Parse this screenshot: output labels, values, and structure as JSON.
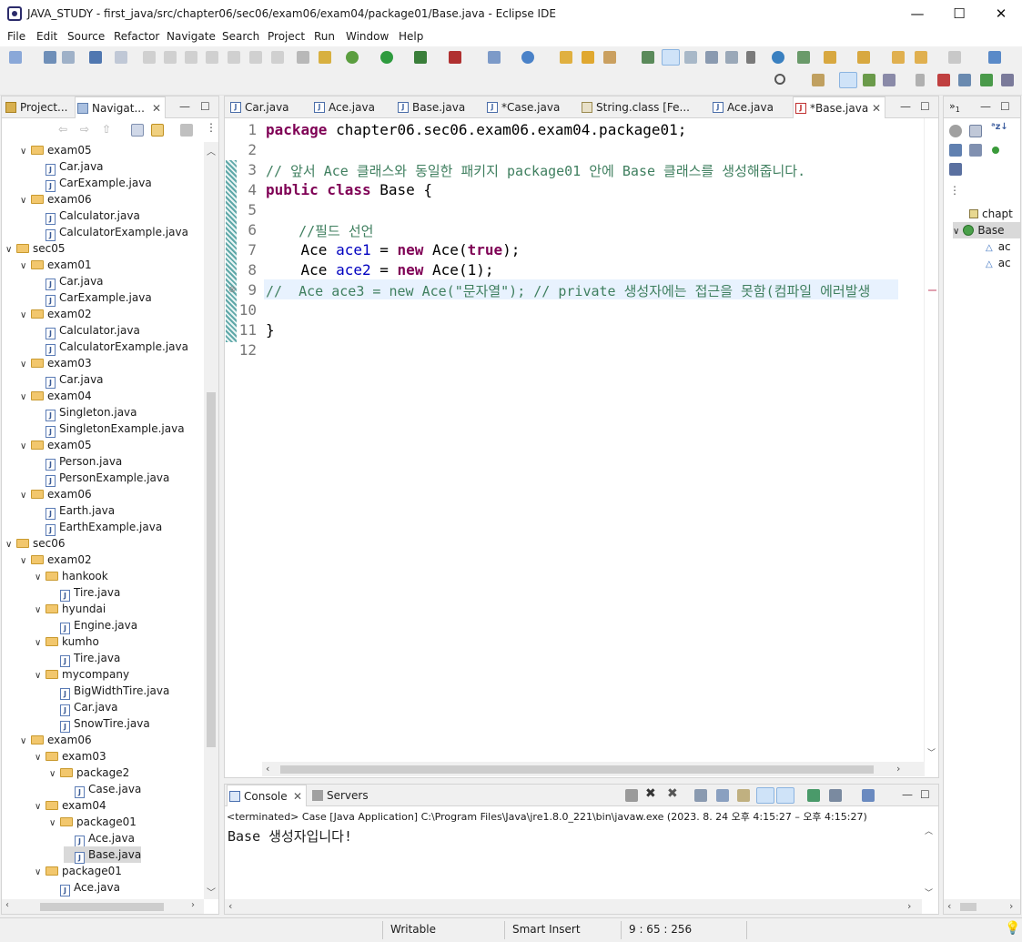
{
  "window": {
    "title": "JAVA_STUDY - first_java/src/chapter06/sec06/exam06/exam04/package01/Base.java - Eclipse IDE",
    "min": "—",
    "max": "☐",
    "close": "✕"
  },
  "menu": [
    "File",
    "Edit",
    "Source",
    "Refactor",
    "Navigate",
    "Search",
    "Project",
    "Run",
    "Window",
    "Help"
  ],
  "left_tabs": [
    "Project...",
    "Navigat..."
  ],
  "tree": [
    {
      "depth": 2,
      "type": "folder",
      "label": "exam05"
    },
    {
      "depth": 3,
      "type": "file",
      "label": "Car.java"
    },
    {
      "depth": 3,
      "type": "file",
      "label": "CarExample.java"
    },
    {
      "depth": 2,
      "type": "folder",
      "label": "exam06"
    },
    {
      "depth": 3,
      "type": "file",
      "label": "Calculator.java"
    },
    {
      "depth": 3,
      "type": "file",
      "label": "CalculatorExample.java"
    },
    {
      "depth": 1,
      "type": "folder",
      "label": "sec05"
    },
    {
      "depth": 2,
      "type": "folder",
      "label": "exam01"
    },
    {
      "depth": 3,
      "type": "file",
      "label": "Car.java"
    },
    {
      "depth": 3,
      "type": "file",
      "label": "CarExample.java"
    },
    {
      "depth": 2,
      "type": "folder",
      "label": "exam02"
    },
    {
      "depth": 3,
      "type": "file",
      "label": "Calculator.java"
    },
    {
      "depth": 3,
      "type": "file",
      "label": "CalculatorExample.java"
    },
    {
      "depth": 2,
      "type": "folder",
      "label": "exam03"
    },
    {
      "depth": 3,
      "type": "file",
      "label": "Car.java"
    },
    {
      "depth": 2,
      "type": "folder",
      "label": "exam04"
    },
    {
      "depth": 3,
      "type": "file",
      "label": "Singleton.java"
    },
    {
      "depth": 3,
      "type": "file",
      "label": "SingletonExample.java"
    },
    {
      "depth": 2,
      "type": "folder",
      "label": "exam05"
    },
    {
      "depth": 3,
      "type": "file",
      "label": "Person.java"
    },
    {
      "depth": 3,
      "type": "file",
      "label": "PersonExample.java"
    },
    {
      "depth": 2,
      "type": "folder",
      "label": "exam06"
    },
    {
      "depth": 3,
      "type": "file",
      "label": "Earth.java"
    },
    {
      "depth": 3,
      "type": "file",
      "label": "EarthExample.java"
    },
    {
      "depth": 1,
      "type": "folder",
      "label": "sec06"
    },
    {
      "depth": 2,
      "type": "folder",
      "label": "exam02"
    },
    {
      "depth": 3,
      "type": "folder",
      "label": "hankook"
    },
    {
      "depth": 4,
      "type": "file",
      "label": "Tire.java"
    },
    {
      "depth": 3,
      "type": "folder",
      "label": "hyundai"
    },
    {
      "depth": 4,
      "type": "file",
      "label": "Engine.java"
    },
    {
      "depth": 3,
      "type": "folder",
      "label": "kumho"
    },
    {
      "depth": 4,
      "type": "file",
      "label": "Tire.java"
    },
    {
      "depth": 3,
      "type": "folder",
      "label": "mycompany"
    },
    {
      "depth": 4,
      "type": "file",
      "label": "BigWidthTire.java"
    },
    {
      "depth": 4,
      "type": "file",
      "label": "Car.java"
    },
    {
      "depth": 4,
      "type": "file",
      "label": "SnowTire.java"
    },
    {
      "depth": 2,
      "type": "folder",
      "label": "exam06"
    },
    {
      "depth": 3,
      "type": "folder",
      "label": "exam03"
    },
    {
      "depth": 4,
      "type": "folder",
      "label": "package2"
    },
    {
      "depth": 5,
      "type": "file",
      "label": "Case.java"
    },
    {
      "depth": 3,
      "type": "folder",
      "label": "exam04"
    },
    {
      "depth": 4,
      "type": "folder",
      "label": "package01"
    },
    {
      "depth": 5,
      "type": "file",
      "label": "Ace.java"
    },
    {
      "depth": 5,
      "type": "file",
      "label": "Base.java",
      "selected": true
    },
    {
      "depth": 3,
      "type": "folder",
      "label": "package01"
    },
    {
      "depth": 4,
      "type": "file",
      "label": "Ace.java"
    }
  ],
  "editor_tabs": [
    "Car.java",
    "Ace.java",
    "Base.java",
    "*Case.java",
    "String.class [Fe...",
    "Ace.java",
    "*Base.java"
  ],
  "line_numbers": [
    "1",
    "2",
    "3",
    "4",
    "5",
    "6",
    "7",
    "8",
    "9",
    "10",
    "11",
    "12"
  ],
  "code": {
    "l1_kw": "package",
    "l1_rest": " chapter06.sec06.exam06.exam04.package01;",
    "l3": "// 앞서 Ace 클래스와 동일한 패키지 package01 안에 Base 클래스를 생성해줍니다.",
    "l4_kw": "public class",
    "l4_rest": " Base {",
    "l6": "    //필드 선언",
    "l7_a": "    Ace ",
    "l7_f": "ace1",
    "l7_b": " = ",
    "l7_kw": "new",
    "l7_c": " Ace(",
    "l7_kw2": "true",
    "l7_d": ");",
    "l8_a": "    Ace ",
    "l8_f": "ace2",
    "l8_b": " = ",
    "l8_kw": "new",
    "l8_c": " Ace(1);",
    "l9": "//  Ace ace3 = new Ace(\"문자열\"); // private 생성자에는 접근을 못함(컴파일 에러발생",
    "l11": "}"
  },
  "console": {
    "tab": "Console",
    "tab2": "Servers",
    "header": "<terminated> Case [Java Application] C:\\Program Files\\Java\\jre1.8.0_221\\bin\\javaw.exe  (2023. 8. 24 오후 4:15:27 – 오후 4:15:27)",
    "output": "Base 생성자입니다!"
  },
  "outline": {
    "items": [
      "chapt",
      "Base",
      "ac",
      "ac"
    ]
  },
  "status": {
    "writable": "Writable",
    "insert": "Smart Insert",
    "position": "9 : 65 : 256"
  },
  "colors": {
    "keyword": "#7f0055",
    "comment": "#3f7f5f",
    "field": "#0000c0",
    "string": "#2a00ff",
    "current_line": "#e8f2fe"
  }
}
